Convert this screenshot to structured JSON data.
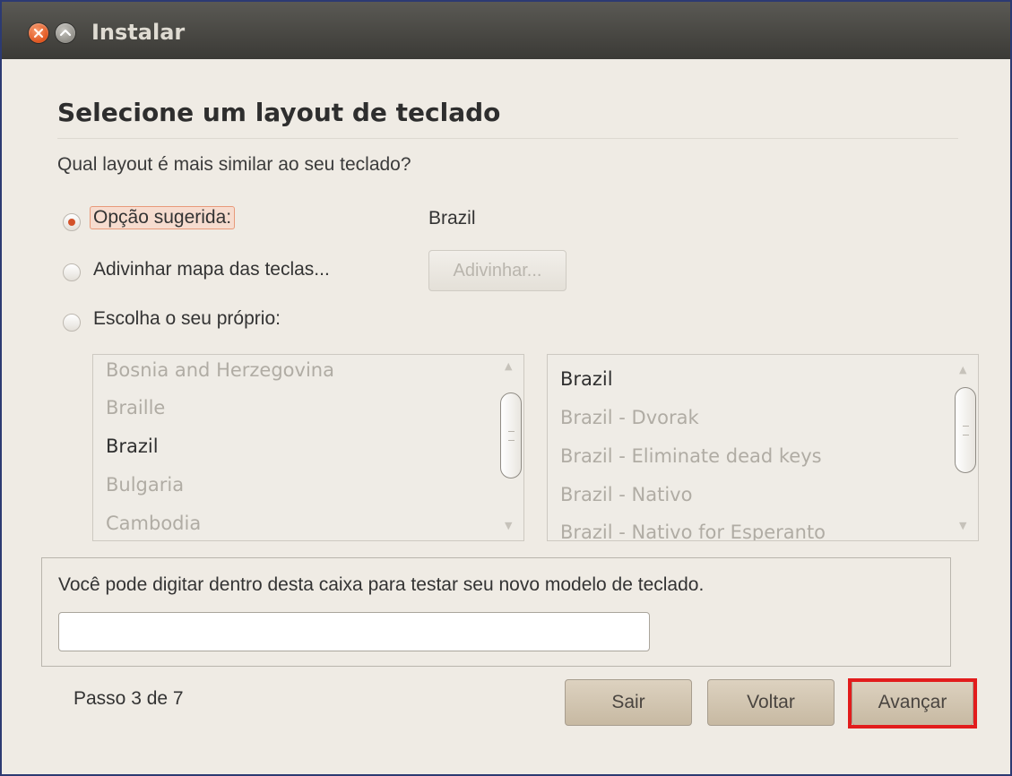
{
  "window": {
    "title": "Instalar"
  },
  "header": {
    "heading": "Selecione um layout de teclado",
    "question": "Qual layout é mais similar ao seu teclado?"
  },
  "options": {
    "suggested": {
      "label": "Opção sugerida:",
      "value": "Brazil",
      "selected": true
    },
    "guess": {
      "label": "Adivinhar mapa das teclas...",
      "button": "Adivinhar..."
    },
    "choose": {
      "label": "Escolha o seu próprio:"
    }
  },
  "countries": {
    "items": [
      "Bosnia and Herzegovina",
      "Braille",
      "Brazil",
      "Bulgaria",
      "Cambodia"
    ],
    "selected": "Brazil"
  },
  "variants": {
    "items": [
      "Brazil",
      "Brazil - Dvorak",
      "Brazil - Eliminate dead keys",
      "Brazil - Nativo",
      "Brazil - Nativo for Esperanto"
    ],
    "selected": "Brazil"
  },
  "test": {
    "label": "Você pode digitar dentro desta caixa para testar seu novo modelo de teclado.",
    "value": ""
  },
  "footer": {
    "step": "Passo 3 de 7",
    "quit": "Sair",
    "back": "Voltar",
    "next": "Avançar"
  },
  "colors": {
    "accent": "#d3522a",
    "highlight": "#e21c1c",
    "titlebar": "#3b3a36"
  }
}
